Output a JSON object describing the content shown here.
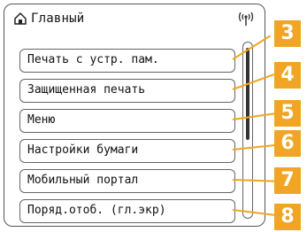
{
  "header": {
    "title": "Главный"
  },
  "menu": [
    {
      "label": "Печать с устр. пам."
    },
    {
      "label": "Защищенная печать"
    },
    {
      "label": "Меню"
    },
    {
      "label": "Настройки бумаги"
    },
    {
      "label": "Мобильный портал"
    },
    {
      "label": "Поряд.отоб. (гл.экр)"
    }
  ],
  "callouts": [
    "3",
    "4",
    "5",
    "6",
    "7",
    "8"
  ],
  "colors": {
    "accent": "#f0a524",
    "border": "#666666"
  },
  "icons": {
    "home": "home-icon",
    "wireless": "wireless-signal-icon"
  }
}
